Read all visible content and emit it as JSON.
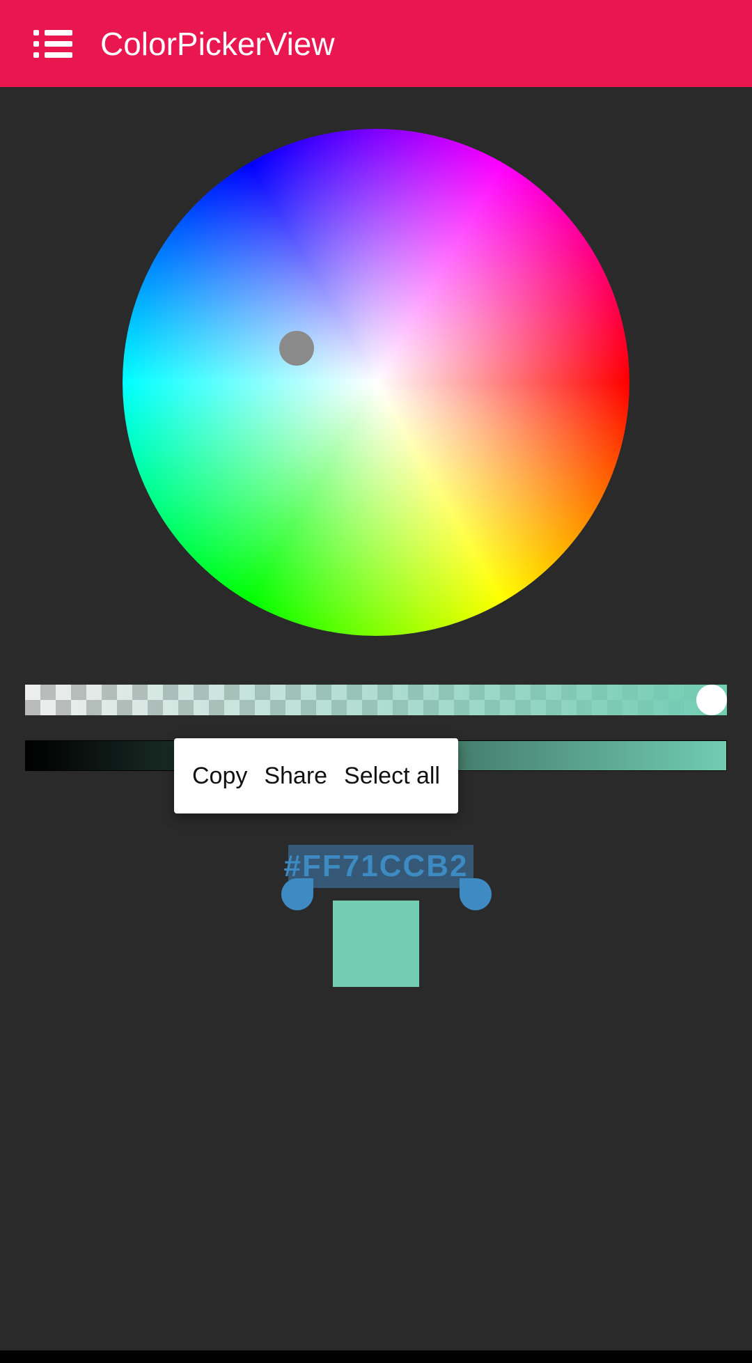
{
  "header": {
    "title": "ColorPickerView"
  },
  "context_menu": {
    "copy": "Copy",
    "share": "Share",
    "select_all": "Select all"
  },
  "color": {
    "hex": "#FF71CCB2",
    "swatch": "#71ccb2"
  }
}
